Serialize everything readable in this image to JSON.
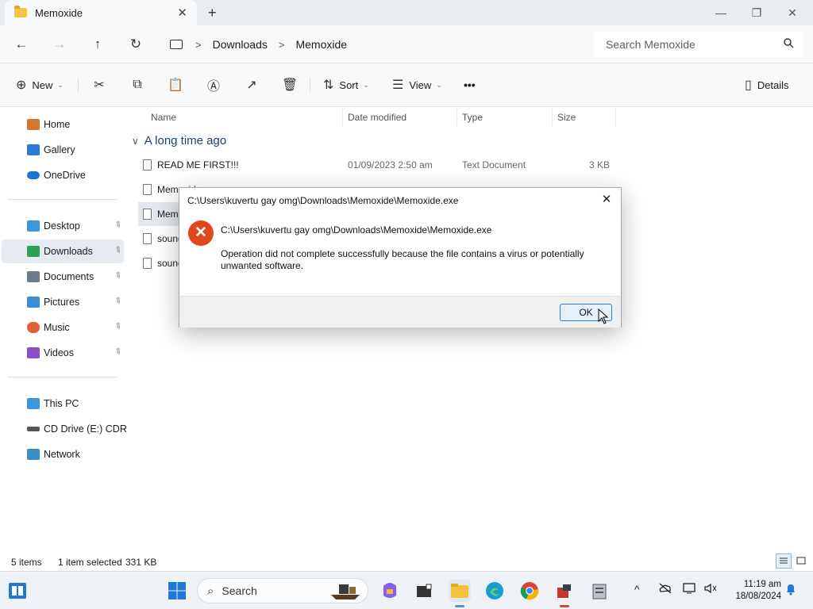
{
  "window": {
    "tab_title": "Memoxide",
    "new_tab": "+",
    "tab_close": "✕",
    "controls": {
      "minimize": "—",
      "maximize": "❐",
      "close": "✕"
    }
  },
  "address": {
    "back": "←",
    "forward": "→",
    "up": "↑",
    "refresh": "↻",
    "separator": ">",
    "crumbs": [
      "Downloads",
      "Memoxide"
    ],
    "search_placeholder": "Search Memoxide"
  },
  "toolbar": {
    "new_label": "New",
    "sort_label": "Sort",
    "view_label": "View",
    "more": "•••",
    "details_label": "Details",
    "icons": {
      "new": "⊕",
      "cut": "✂",
      "copy": "⧉",
      "paste": "📋",
      "rename": "Ⓐ",
      "share": "↗",
      "delete": "🗑",
      "sort": "⇅",
      "view": "☰",
      "details": "▯",
      "caret": "⌄"
    }
  },
  "sidebar": {
    "items": [
      {
        "label": "Home",
        "color": "#d4772c"
      },
      {
        "label": "Gallery",
        "color": "#2b7bd6"
      },
      {
        "label": "OneDrive",
        "color": "#1e73d0"
      },
      {
        "label": "Desktop",
        "color": "#3a9ad9"
      },
      {
        "label": "Downloads",
        "color": "#2f9e59"
      },
      {
        "label": "Documents",
        "color": "#6d7c8c"
      },
      {
        "label": "Pictures",
        "color": "#3b8fd6"
      },
      {
        "label": "Music",
        "color": "#e0603a"
      },
      {
        "label": "Videos",
        "color": "#8a4fc7"
      },
      {
        "label": "This PC",
        "color": "#3a9ad9"
      },
      {
        "label": "CD Drive (E:) CDRO",
        "color": "#555555"
      },
      {
        "label": "Network",
        "color": "#3a8fc8"
      }
    ],
    "expand_glyph": ">",
    "pin_glyph": "📌"
  },
  "filelist": {
    "columns": [
      "Name",
      "Date modified",
      "Type",
      "Size"
    ],
    "group": "A long time ago",
    "group_chevron": "∨",
    "rows": [
      {
        "name": "READ ME FIRST!!!",
        "date": "01/09/2023 2:50 am",
        "type": "Text Document",
        "size": "3 KB"
      },
      {
        "name": "Memoxide.exe",
        "date": "",
        "type": "",
        "size": ""
      },
      {
        "name": "Mem",
        "date": "",
        "type": "",
        "size": ""
      },
      {
        "name": "sound",
        "date": "",
        "type": "",
        "size": ""
      },
      {
        "name": "sound",
        "date": "",
        "type": "",
        "size": ""
      }
    ]
  },
  "status": {
    "items": "5 items",
    "selection": "1 item selected",
    "size": "331 KB"
  },
  "dialog": {
    "title": "C:\\Users\\kuvertu gay omg\\Downloads\\Memoxide\\Memoxide.exe",
    "close": "✕",
    "error_glyph": "✕",
    "path": "C:\\Users\\kuvertu gay omg\\Downloads\\Memoxide\\Memoxide.exe",
    "message": "Operation did not complete successfully because the file contains a virus or potentially unwanted software.",
    "ok_label": "OK"
  },
  "taskbar": {
    "search_label": "Search",
    "search_glyph": "⌕",
    "tray": {
      "chevron": "^",
      "time": "11:19 am",
      "date": "18/08/2024"
    },
    "colors": {
      "start": "#1e78d4",
      "explorer": "#f3c13a",
      "edge": "#1b9ad6",
      "chrome_red": "#db4437",
      "chrome_yellow": "#f4b400",
      "chrome_green": "#0f9d58"
    }
  }
}
